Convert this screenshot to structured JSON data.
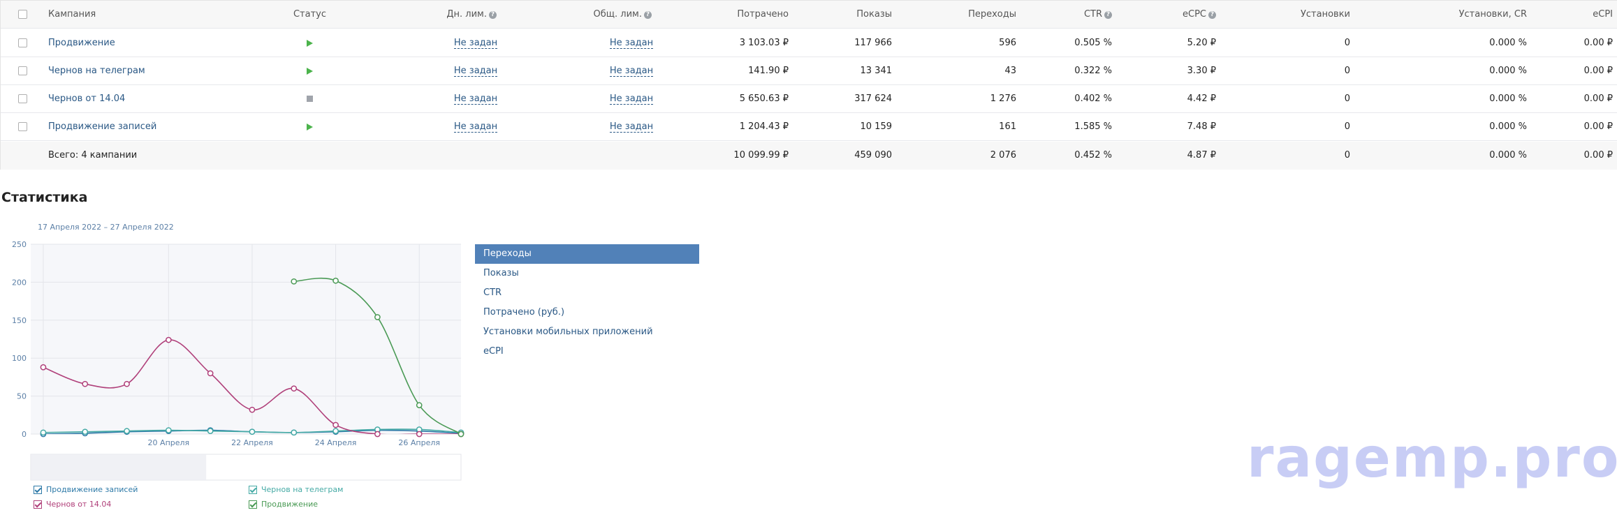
{
  "table": {
    "headers": {
      "campaign": "Кампания",
      "status": "Статус",
      "daily_limit": "Дн. лим.",
      "total_limit": "Общ. лим.",
      "spent": "Потрачено",
      "impressions": "Показы",
      "clicks": "Переходы",
      "ctr": "CTR",
      "ecpc": "eCPC",
      "installs": "Установки",
      "installs_cr": "Установки, CR",
      "ecpi": "eCPI"
    },
    "rows": [
      {
        "name": "Продвижение",
        "status": "play",
        "daily_limit": "Не задан",
        "total_limit": "Не задан",
        "spent": "3 103.03 ₽",
        "impressions": "117 966",
        "clicks": "596",
        "ctr": "0.505 %",
        "ecpc": "5.20 ₽",
        "installs": "0",
        "installs_cr": "0.000 %",
        "ecpi": "0.00 ₽"
      },
      {
        "name": "Чернов на телеграм",
        "status": "play",
        "daily_limit": "Не задан",
        "total_limit": "Не задан",
        "spent": "141.90 ₽",
        "impressions": "13 341",
        "clicks": "43",
        "ctr": "0.322 %",
        "ecpc": "3.30 ₽",
        "installs": "0",
        "installs_cr": "0.000 %",
        "ecpi": "0.00 ₽"
      },
      {
        "name": "Чернов от 14.04",
        "status": "stop",
        "daily_limit": "Не задан",
        "total_limit": "Не задан",
        "spent": "5 650.63 ₽",
        "impressions": "317 624",
        "clicks": "1 276",
        "ctr": "0.402 %",
        "ecpc": "4.42 ₽",
        "installs": "0",
        "installs_cr": "0.000 %",
        "ecpi": "0.00 ₽"
      },
      {
        "name": "Продвижение записей",
        "status": "play",
        "daily_limit": "Не задан",
        "total_limit": "Не задан",
        "spent": "1 204.43 ₽",
        "impressions": "10 159",
        "clicks": "161",
        "ctr": "1.585 %",
        "ecpc": "7.48 ₽",
        "installs": "0",
        "installs_cr": "0.000 %",
        "ecpi": "0.00 ₽"
      }
    ],
    "total": {
      "label": "Всего: 4 кампании",
      "spent": "10 099.99 ₽",
      "impressions": "459 090",
      "clicks": "2 076",
      "ctr": "0.452 %",
      "ecpc": "4.87 ₽",
      "installs": "0",
      "installs_cr": "0.000 %",
      "ecpi": "0.00 ₽"
    }
  },
  "stats": {
    "title": "Статистика",
    "period": "17 Апреля 2022 – 27 Апреля 2022",
    "metrics": [
      "Переходы",
      "Показы",
      "CTR",
      "Потрачено (руб.)",
      "Установки мобильных приложений",
      "eCPI"
    ],
    "active_metric": "Переходы"
  },
  "chart_data": {
    "type": "line",
    "ylim": [
      0,
      250
    ],
    "yticks": [
      "0",
      "50",
      "100",
      "150",
      "200",
      "250"
    ],
    "xticks": [
      {
        "day": 20,
        "label": "20 Апреля"
      },
      {
        "day": 22,
        "label": "22 Апреля"
      },
      {
        "day": 24,
        "label": "24 Апреля"
      },
      {
        "day": 26,
        "label": "26 Апреля"
      }
    ],
    "series": [
      {
        "name": "Продвижение записей",
        "color": "#2e7aa8",
        "visible": true,
        "points": [
          [
            17,
            0
          ],
          [
            18,
            1
          ],
          [
            19,
            3
          ],
          [
            20,
            4
          ],
          [
            21,
            5
          ],
          [
            22,
            3
          ],
          [
            23,
            2
          ],
          [
            24,
            3
          ],
          [
            25,
            5
          ],
          [
            26,
            4
          ],
          [
            27,
            1
          ]
        ]
      },
      {
        "name": "Чернов на телеграм",
        "color": "#45aaa5",
        "visible": true,
        "points": [
          [
            17,
            2
          ],
          [
            18,
            3
          ],
          [
            19,
            4
          ],
          [
            20,
            5
          ],
          [
            21,
            4
          ],
          [
            22,
            3
          ],
          [
            23,
            2
          ],
          [
            24,
            4
          ],
          [
            25,
            6
          ],
          [
            26,
            6
          ],
          [
            27,
            2
          ]
        ]
      },
      {
        "name": "Чернов от 14.04",
        "color": "#b0407a",
        "visible": true,
        "points": [
          [
            17,
            88
          ],
          [
            18,
            66
          ],
          [
            19,
            66
          ],
          [
            20,
            124
          ],
          [
            21,
            80
          ],
          [
            22,
            32
          ],
          [
            23,
            60
          ],
          [
            24,
            12
          ],
          [
            25,
            0
          ],
          [
            26,
            0
          ],
          [
            27,
            0
          ]
        ]
      },
      {
        "name": "Продвижение",
        "color": "#4a9a55",
        "visible": true,
        "points": [
          [
            23,
            201
          ],
          [
            24,
            202
          ],
          [
            25,
            154
          ],
          [
            26,
            38
          ],
          [
            27,
            0
          ]
        ]
      }
    ]
  },
  "legend": [
    {
      "name": "Продвижение записей",
      "color": "#2e7aa8"
    },
    {
      "name": "Чернов на телеграм",
      "color": "#45aaa5"
    },
    {
      "name": "Чернов от 14.04",
      "color": "#b0407a"
    },
    {
      "name": "Продвижение",
      "color": "#4a9a55"
    }
  ],
  "watermark": "ragemp.pro"
}
